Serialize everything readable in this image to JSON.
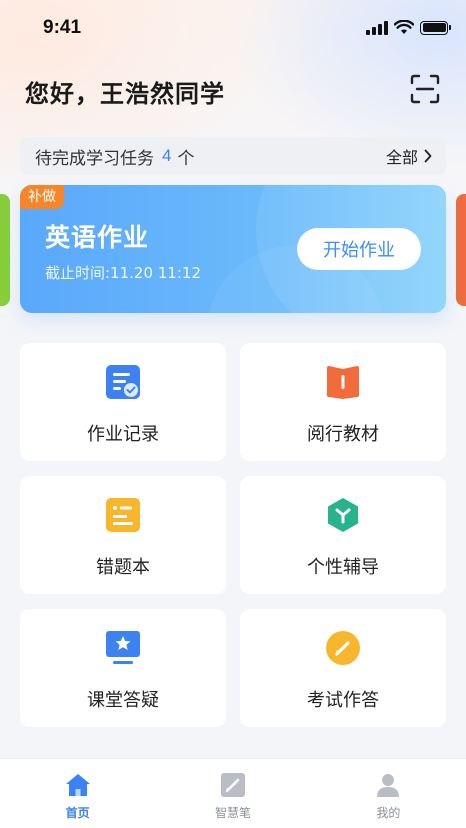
{
  "status_bar": {
    "time": "9:41"
  },
  "greeting": "您好，王浩然同学",
  "tasks": {
    "label": "待完成学习任务",
    "count": "4",
    "unit": "个",
    "all_label": "全部"
  },
  "homework_card": {
    "badge": "补做",
    "title": "英语作业",
    "deadline": "截止时间:11.20 11:12",
    "start_label": "开始作业"
  },
  "features": [
    {
      "label": "作业记录",
      "icon": "homework-record-icon",
      "color": "#3c82f0"
    },
    {
      "label": "阅行教材",
      "icon": "textbook-icon",
      "color": "#f26b3a"
    },
    {
      "label": "错题本",
      "icon": "mistake-notebook-icon",
      "color": "#f8b62d"
    },
    {
      "label": "个性辅导",
      "icon": "personal-tutoring-icon",
      "color": "#27b48c"
    },
    {
      "label": "课堂答疑",
      "icon": "classroom-qa-icon",
      "color": "#3c82f0"
    },
    {
      "label": "考试作答",
      "icon": "exam-answer-icon",
      "color": "#f8b62d"
    }
  ],
  "tabbar": {
    "items": [
      {
        "label": "首页",
        "icon": "home-icon",
        "active": true
      },
      {
        "label": "智慧笔",
        "icon": "smart-pen-icon",
        "active": false
      },
      {
        "label": "我的",
        "icon": "profile-icon",
        "active": false
      }
    ]
  },
  "colors": {
    "accent": "#3b82f6",
    "badge": "#f7852a",
    "card_start": "#5aa8fb",
    "card_end": "#8bd3fb"
  }
}
